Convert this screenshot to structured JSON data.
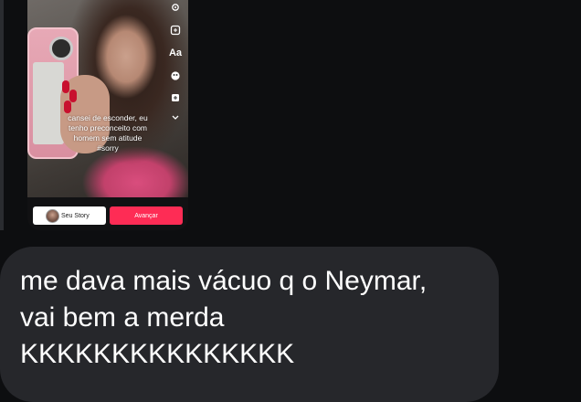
{
  "story": {
    "caption": "cansei de esconder, eu\ntenho preconceito com\nhomem sem atitude\n#sorry",
    "tools": [
      "settings-icon",
      "sticker-icon",
      "text-icon",
      "effects-icon",
      "crop-icon",
      "more-icon"
    ],
    "text_tool_label": "Aa",
    "your_story_label": "Seu Story",
    "next_label": "Avançar"
  },
  "message": {
    "text": "me dava mais vácuo q o Neymar,\nvai bem a merda\nKKKKKKKKKKKKKKK"
  },
  "colors": {
    "background": "#0d0e10",
    "bubble": "#26272b",
    "accent": "#fe2c55"
  }
}
